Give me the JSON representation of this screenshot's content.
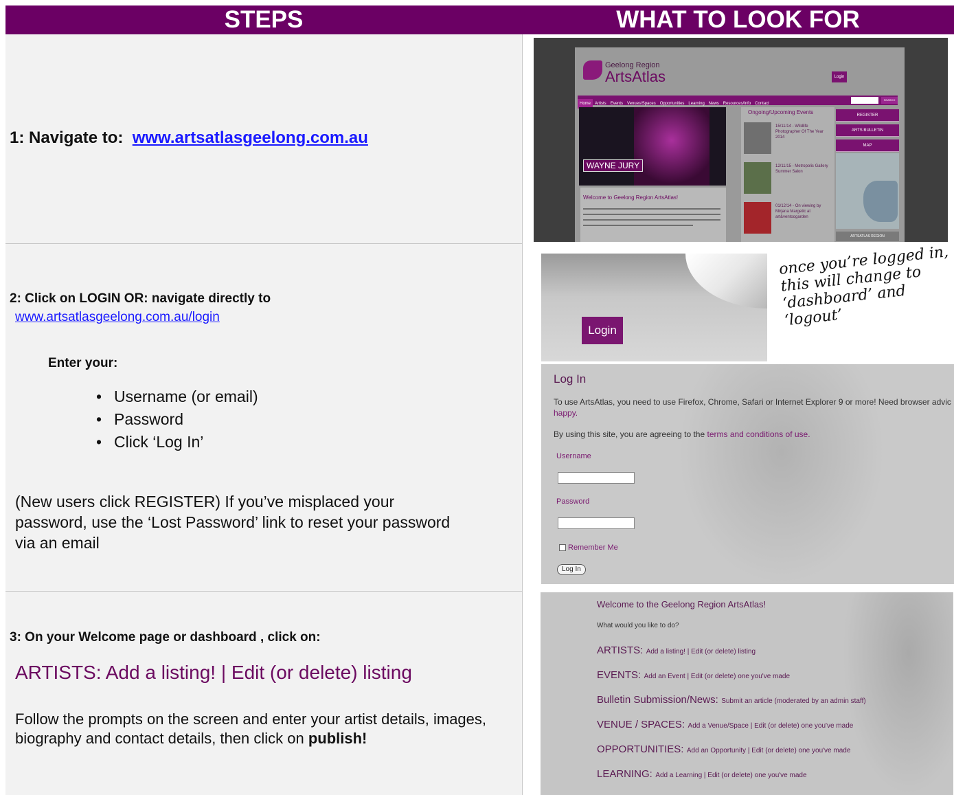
{
  "header": {
    "steps": "STEPS",
    "look": "WHAT TO LOOK FOR"
  },
  "step1": {
    "prefix": "1: Navigate to:",
    "link": "www.artsatlasgeelong.com.au"
  },
  "step2": {
    "title": "2: Click on LOGIN OR: navigate directly to",
    "link": "www.artsatlasgeelong.com.au/login",
    "enter": "Enter your:",
    "bullets": [
      "Username (or email)",
      "Password",
      "Click ‘Log In’"
    ],
    "note": "(New users click REGISTER) If you’ve misplaced your password, use the ‘Lost Password’ link to reset your password via an email"
  },
  "step3": {
    "title": "3: On your Welcome page or dashboard , click on:",
    "highlight": "ARTISTS: Add a listing! | Edit (or delete) listing",
    "body": "Follow the prompts on the screen and enter your artist details, images, biography and contact details, then click on",
    "bold": "publish!"
  },
  "shot1": {
    "logo_small": "Geelong Region",
    "logo_big": "ArtsAtlas",
    "login": "Login",
    "nav": [
      "Home",
      "Artists",
      "Events",
      "Venues/Spaces",
      "Opportunities",
      "Learning",
      "News",
      "Resources/Info",
      "Contact"
    ],
    "search": "SEARCH",
    "hero_tag": "WAYNE JURY",
    "welcome": "Welcome to Geelong Region ArtsAtlas!",
    "events_title": "Ongoing/Upcoming Events",
    "events": [
      "15/11/14 - Wildlife Photographer Of The Year 2014",
      "12/11/15 - Metropolis Gallery Summer Salon",
      "01/12/14 - On viewing by Mirjana Margetic at art&ventoogarden"
    ],
    "buttons": [
      "REGISTER",
      "ARTS BULLETIN",
      "MAP"
    ],
    "region": "ARTSATLAS REGION"
  },
  "shot2": {
    "login": "Login",
    "note": "once you’re logged in, this will change to ‘dashboard’ and ‘logout’"
  },
  "shot3": {
    "title": "Log In",
    "p1": "To use ArtsAtlas, you need to use Firefox, Chrome, Safari or Internet Explorer 9 or more! Need browser advic",
    "p1b": "happy.",
    "p2a": "By using this site, you are agreeing to the",
    "p2b": "terms and conditions of use.",
    "username": "Username",
    "password": "Password",
    "remember": "Remember Me",
    "button": "Log In"
  },
  "shot4": {
    "title": "Welcome to the Geelong Region ArtsAtlas!",
    "question": "What would you like to do?",
    "lines": [
      {
        "big": "ARTISTS:",
        "small": "Add a listing! | Edit (or delete) listing"
      },
      {
        "big": "EVENTS:",
        "small": "Add an Event | Edit (or delete) one you've made"
      },
      {
        "big": "Bulletin Submission/News:",
        "small": "Submit an article (moderated by an admin staff)"
      },
      {
        "big": "VENUE / SPACES:",
        "small": "Add a Venue/Space | Edit (or delete) one you've made"
      },
      {
        "big": "OPPORTUNITIES:",
        "small": "Add an Opportunity | Edit (or delete) one you've made"
      },
      {
        "big": "LEARNING:",
        "small": "Add a Learning | Edit (or delete) one you've made"
      }
    ]
  }
}
